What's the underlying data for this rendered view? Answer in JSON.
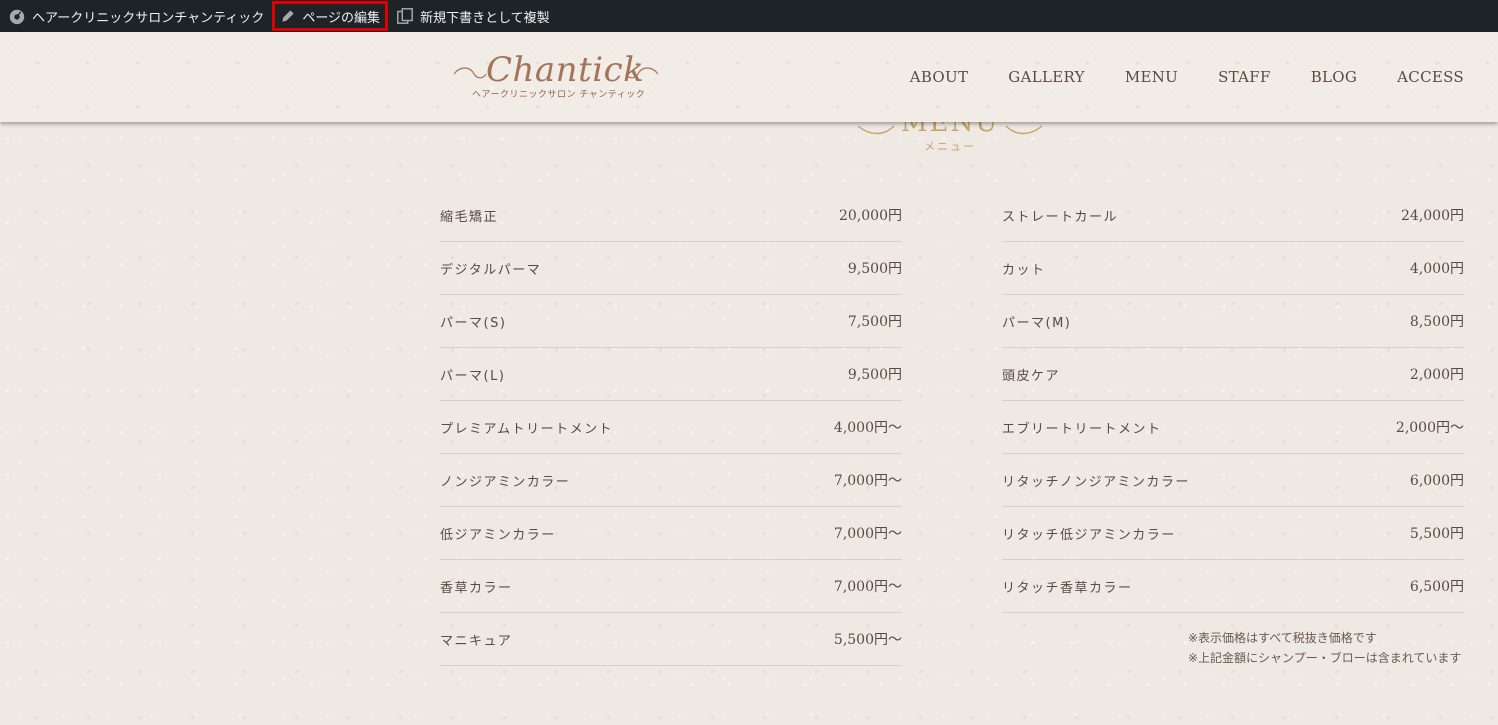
{
  "admin_bar": {
    "site_name": "ヘアークリニックサロンチャンティック",
    "edit_page": "ページの編集",
    "duplicate_draft": "新規下書きとして複製"
  },
  "header": {
    "logo_text": "Chantick",
    "logo_sub": "ヘアークリニックサロン チャンティック",
    "nav": [
      "ABOUT",
      "GALLERY",
      "MENU",
      "STAFF",
      "BLOG",
      "ACCESS"
    ]
  },
  "section": {
    "title": "MENU",
    "subtitle": "メニュー"
  },
  "menu": {
    "left": [
      {
        "name": "縮毛矯正",
        "price": "20,000円"
      },
      {
        "name": "デジタルパーマ",
        "price": "9,500円"
      },
      {
        "name": "パーマ(S)",
        "price": "7,500円"
      },
      {
        "name": "パーマ(L)",
        "price": "9,500円"
      },
      {
        "name": "プレミアムトリートメント",
        "price": "4,000円〜"
      },
      {
        "name": "ノンジアミンカラー",
        "price": "7,000円〜"
      },
      {
        "name": "低ジアミンカラー",
        "price": "7,000円〜"
      },
      {
        "name": "香草カラー",
        "price": "7,000円〜"
      },
      {
        "name": "マニキュア",
        "price": "5,500円〜"
      }
    ],
    "right": [
      {
        "name": "ストレートカール",
        "price": "24,000円"
      },
      {
        "name": "カット",
        "price": "4,000円"
      },
      {
        "name": "パーマ(M)",
        "price": "8,500円"
      },
      {
        "name": "頭皮ケア",
        "price": "2,000円"
      },
      {
        "name": "エブリートリートメント",
        "price": "2,000円〜"
      },
      {
        "name": "リタッチノンジアミンカラー",
        "price": "6,000円"
      },
      {
        "name": "リタッチ低ジアミンカラー",
        "price": "5,500円"
      },
      {
        "name": "リタッチ香草カラー",
        "price": "6,500円"
      }
    ],
    "notes": [
      "※表示価格はすべて税抜き価格です",
      "※上記金額にシャンプー・ブローは含まれています"
    ]
  }
}
